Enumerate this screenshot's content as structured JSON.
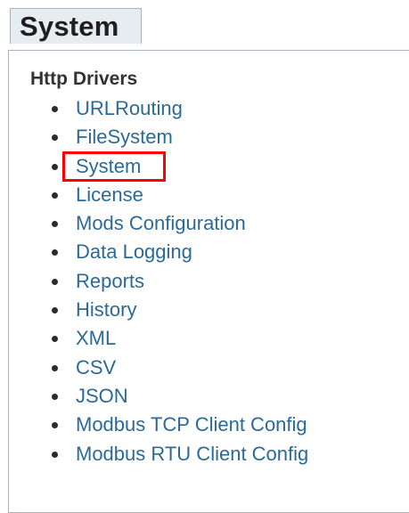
{
  "tab": {
    "title": "System"
  },
  "section": {
    "heading": "Http Drivers"
  },
  "items": [
    {
      "label": "URLRouting"
    },
    {
      "label": "FileSystem"
    },
    {
      "label": "System"
    },
    {
      "label": "License"
    },
    {
      "label": "Mods Configuration"
    },
    {
      "label": "Data Logging"
    },
    {
      "label": "Reports"
    },
    {
      "label": "History"
    },
    {
      "label": "XML"
    },
    {
      "label": "CSV"
    },
    {
      "label": "JSON"
    },
    {
      "label": "Modbus TCP Client Config"
    },
    {
      "label": "Modbus RTU Client Config"
    }
  ],
  "colors": {
    "link": "#2b6a96",
    "tab_bg": "#e7ecf0",
    "highlight": "#ff0000"
  }
}
